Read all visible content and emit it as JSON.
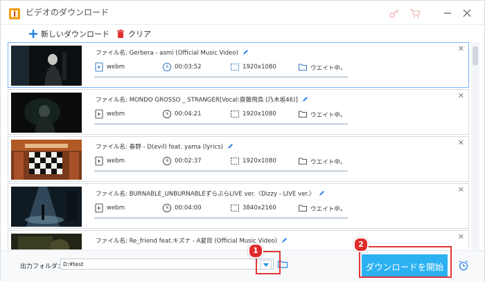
{
  "window": {
    "title": "ビデオのダウンロード"
  },
  "toolbar": {
    "new_download_label": "新しいダウンロード",
    "clear_label": "クリア"
  },
  "items": [
    {
      "filename": "ファイル名: Gerbera - asmi (Official Music Video)",
      "format": "webm",
      "duration": "00:03:52",
      "resolution": "1920x1080",
      "status": "ウエイト中。"
    },
    {
      "filename": "ファイル名: MONDO GROSSO _ STRANGER[Vocal:齋藤飛鳥 (乃木坂46)]",
      "format": "webm",
      "duration": "00:04:21",
      "resolution": "1920x1080",
      "status": "ウエイト中。"
    },
    {
      "filename": "ファイル名: 春野 - D(evil) feat. yama (lyrics)",
      "format": "webm",
      "duration": "00:02:37",
      "resolution": "1920x1080",
      "status": "ウエイト中。"
    },
    {
      "filename": "ファイル名: BURNABLE_UNBURNABLEずらぶらLIVE ver.〈Dizzy - LIVE ver.〉",
      "format": "webm",
      "duration": "00:04:00",
      "resolution": "3840x2160",
      "status": "ウエイト中。"
    },
    {
      "filename": "ファイル名: Re_friend feat.キズナ - A夏目 (Official Music Video)"
    }
  ],
  "bottom": {
    "output_label": "出力フォルダ：",
    "output_path": "D:¥test",
    "start_label": "ダウンロードを開始"
  },
  "annotations": [
    "1",
    "2"
  ],
  "colors": {
    "accent": "#2bb1f2",
    "highlight": "#e23434",
    "selected_border": "#7ab4ff"
  }
}
